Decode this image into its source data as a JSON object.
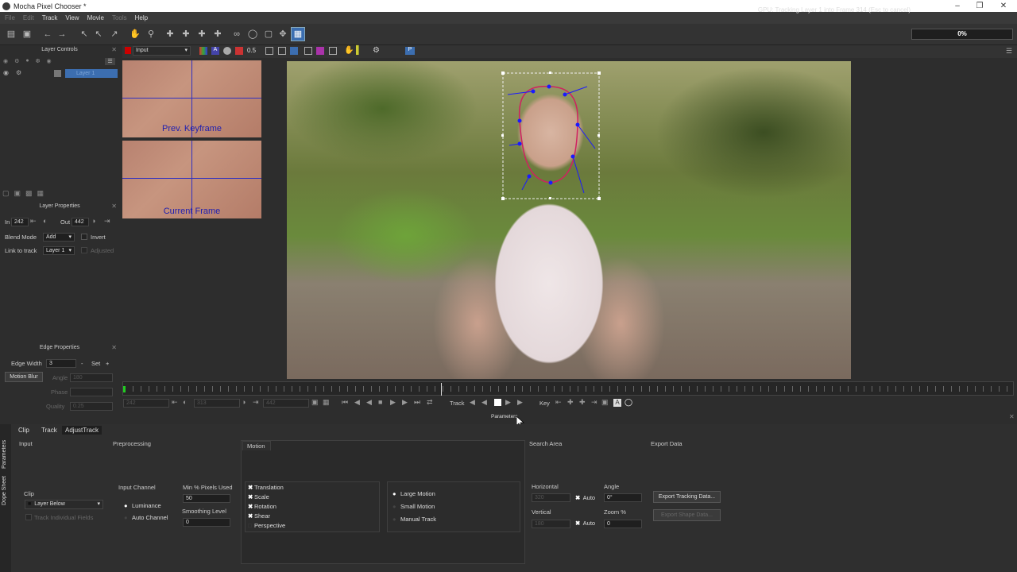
{
  "window": {
    "title": "Mocha Pixel Chooser *"
  },
  "menu": [
    {
      "label": "File",
      "enabled": false
    },
    {
      "label": "Edit",
      "enabled": false
    },
    {
      "label": "Track",
      "enabled": true
    },
    {
      "label": "View",
      "enabled": true
    },
    {
      "label": "Movie",
      "enabled": true
    },
    {
      "label": "Tools",
      "enabled": false
    },
    {
      "label": "Help",
      "enabled": true
    }
  ],
  "status": {
    "text": "GPU: Tracking Layer 1 into Frame 314 (Esc to cancel)",
    "progress": "0%"
  },
  "view_bar": {
    "input_select": "Input",
    "zoom_value": "0.5"
  },
  "layer_controls": {
    "title": "Layer Controls",
    "layers": [
      {
        "name": "Layer 1"
      }
    ]
  },
  "thumbnails": {
    "prev": "Prev. Keyframe",
    "current": "Current Frame"
  },
  "layer_properties": {
    "title": "Layer Properties",
    "in_label": "In",
    "in_value": "242",
    "out_label": "Out",
    "out_value": "442",
    "blend_mode_label": "Blend Mode",
    "blend_mode_value": "Add",
    "invert_label": "Invert",
    "link_to_track_label": "Link to track",
    "link_to_track_value": "Layer 1",
    "adjusted_label": "Adjusted"
  },
  "edge_properties": {
    "title": "Edge Properties",
    "edge_width_label": "Edge Width",
    "edge_width_value": "3",
    "minus": "-",
    "set": "Set",
    "plus": "+",
    "motion_blur_label": "Motion Blur",
    "angle_label": "Angle",
    "angle_value": "180",
    "phase_label": "Phase",
    "phase_value": "",
    "quality_label": "Quality",
    "quality_value": "0.25"
  },
  "transport": {
    "frame_start": "242",
    "frame_current": "313",
    "frame_end": "442",
    "track_label": "Track",
    "key_label": "Key",
    "parameters_label": "Parameters"
  },
  "bottom_tabs": [
    {
      "label": "Clip",
      "selected": false
    },
    {
      "label": "Track",
      "selected": true
    },
    {
      "label": "AdjustTrack",
      "selected": false
    }
  ],
  "side_tabs": [
    "Parameters",
    "Dope Sheet"
  ],
  "params": {
    "input": {
      "title": "Input",
      "clip_label": "Clip",
      "clip_value": "Layer Below",
      "track_individual_fields": "Track Individual Fields"
    },
    "preprocessing": {
      "title": "Preprocessing",
      "input_channel_label": "Input Channel",
      "luminance": "Luminance",
      "auto_channel": "Auto Channel",
      "min_pixels_label": "Min % Pixels Used",
      "min_pixels_value": "50",
      "smoothing_label": "Smoothing Level",
      "smoothing_value": "0"
    },
    "motion": {
      "title": "Motion",
      "options": [
        {
          "label": "Translation",
          "checked": true
        },
        {
          "label": "Scale",
          "checked": true
        },
        {
          "label": "Rotation",
          "checked": true
        },
        {
          "label": "Shear",
          "checked": true
        },
        {
          "label": "Perspective",
          "checked": false
        }
      ],
      "modes": [
        {
          "label": "Large Motion",
          "selected": true
        },
        {
          "label": "Small Motion",
          "selected": false
        },
        {
          "label": "Manual Track",
          "selected": false
        }
      ]
    },
    "search_area": {
      "title": "Search Area",
      "horizontal_label": "Horizontal",
      "horizontal_value": "320",
      "vertical_label": "Vertical",
      "vertical_value": "180",
      "auto_label": "Auto",
      "angle_label": "Angle",
      "angle_value": "0°",
      "zoom_label": "Zoom %",
      "zoom_value": "0"
    },
    "export_data": {
      "title": "Export Data",
      "export_tracking": "Export Tracking Data...",
      "export_shape": "Export Shape Data..."
    }
  }
}
